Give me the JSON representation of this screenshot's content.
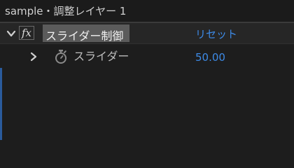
{
  "panel": {
    "title": "sample・調整レイヤー 1"
  },
  "effect": {
    "fx_label": "fx",
    "name": "スライダー制御",
    "reset_label": "リセット",
    "expanded": true
  },
  "parameter": {
    "name": "スライダー",
    "value": "50.00",
    "expanded": false
  },
  "colors": {
    "background": "#1d1d1d",
    "header_row": "#262626",
    "selected_name": "#5b5b5b",
    "link_blue": "#3d8ae6",
    "accent_edge": "#2a5b9c"
  },
  "icons": {
    "expand": "chevron-down-icon",
    "collapse": "chevron-right-icon",
    "keyframe": "stopwatch-icon"
  }
}
